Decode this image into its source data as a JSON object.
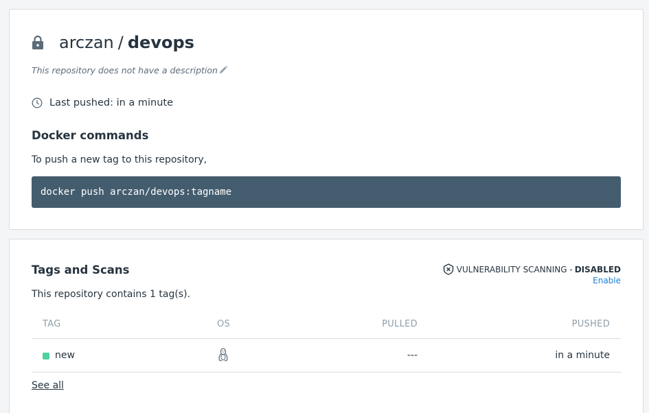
{
  "repo": {
    "namespace": "arczan",
    "separator": "/",
    "name": "devops",
    "description": "This repository does not have a description",
    "last_pushed": "Last pushed: in a minute",
    "docker_commands_heading": "Docker commands",
    "push_instructions": "To push a new tag to this repository,",
    "push_command": "docker push arczan/devops:tagname",
    "icons": {
      "lock": "lock-icon",
      "edit": "pencil-icon",
      "clock": "clock-icon"
    }
  },
  "tags": {
    "heading": "Tags and Scans",
    "vuln_label": "VULNERABILITY SCANNING -",
    "vuln_status": "DISABLED",
    "enable_label": "Enable",
    "count_text": "This repository contains 1 tag(s).",
    "columns": {
      "tag": "TAG",
      "os": "OS",
      "pulled": "PULLED",
      "pushed": "PUSHED"
    },
    "rows": [
      {
        "tag": "new",
        "os": "linux-icon",
        "pulled": "---",
        "pushed": "in a minute"
      }
    ],
    "see_all": "See all"
  },
  "colors": {
    "command_bg": "#445d6e",
    "tag_dot": "#4fd1a1",
    "link": "#1a7fd4"
  }
}
